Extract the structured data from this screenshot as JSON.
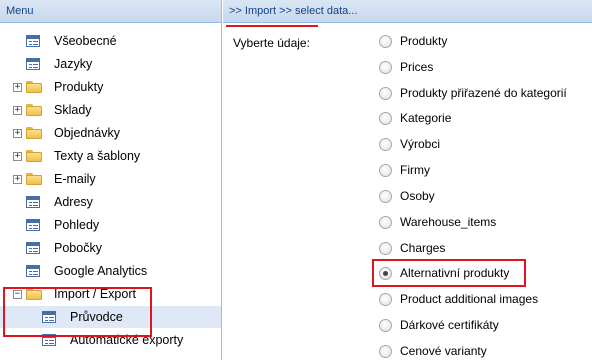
{
  "menu": {
    "title": "Menu",
    "items": [
      {
        "label": "Všeobecné",
        "type": "leaf"
      },
      {
        "label": "Jazyky",
        "type": "leaf"
      },
      {
        "label": "Produkty",
        "type": "folder"
      },
      {
        "label": "Sklady",
        "type": "folder"
      },
      {
        "label": "Objednávky",
        "type": "folder"
      },
      {
        "label": "Texty a šablony",
        "type": "folder"
      },
      {
        "label": "E-maily",
        "type": "folder"
      },
      {
        "label": "Adresy",
        "type": "leaf"
      },
      {
        "label": "Pohledy",
        "type": "leaf"
      },
      {
        "label": "Pobočky",
        "type": "leaf"
      },
      {
        "label": "Google Analytics",
        "type": "leaf"
      },
      {
        "label": "Import / Export",
        "type": "folder-open"
      },
      {
        "label": "Průvodce",
        "type": "leaf-child",
        "selected": true
      },
      {
        "label": "Automatické exporty",
        "type": "leaf-child"
      }
    ]
  },
  "main": {
    "breadcrumb": ">> Import >> select data...",
    "field_label": "Vyberte údaje:",
    "options": [
      {
        "label": "Produkty",
        "checked": false
      },
      {
        "label": "Prices",
        "checked": false
      },
      {
        "label": "Produkty přiřazené do kategorií",
        "checked": false
      },
      {
        "label": "Kategorie",
        "checked": false
      },
      {
        "label": "Výrobci",
        "checked": false
      },
      {
        "label": "Firmy",
        "checked": false
      },
      {
        "label": "Osoby",
        "checked": false
      },
      {
        "label": "Warehouse_items",
        "checked": false
      },
      {
        "label": "Charges",
        "checked": false
      },
      {
        "label": "Alternativní produkty",
        "checked": true
      },
      {
        "label": "Product additional images",
        "checked": false
      },
      {
        "label": "Dárkové certifikáty",
        "checked": false
      },
      {
        "label": "Cenové varianty",
        "checked": false
      }
    ]
  },
  "colors": {
    "header_text": "#15428b",
    "panel_border": "#99bbe8",
    "highlight": "#e0141e",
    "selected_row": "#dfe8f6"
  }
}
